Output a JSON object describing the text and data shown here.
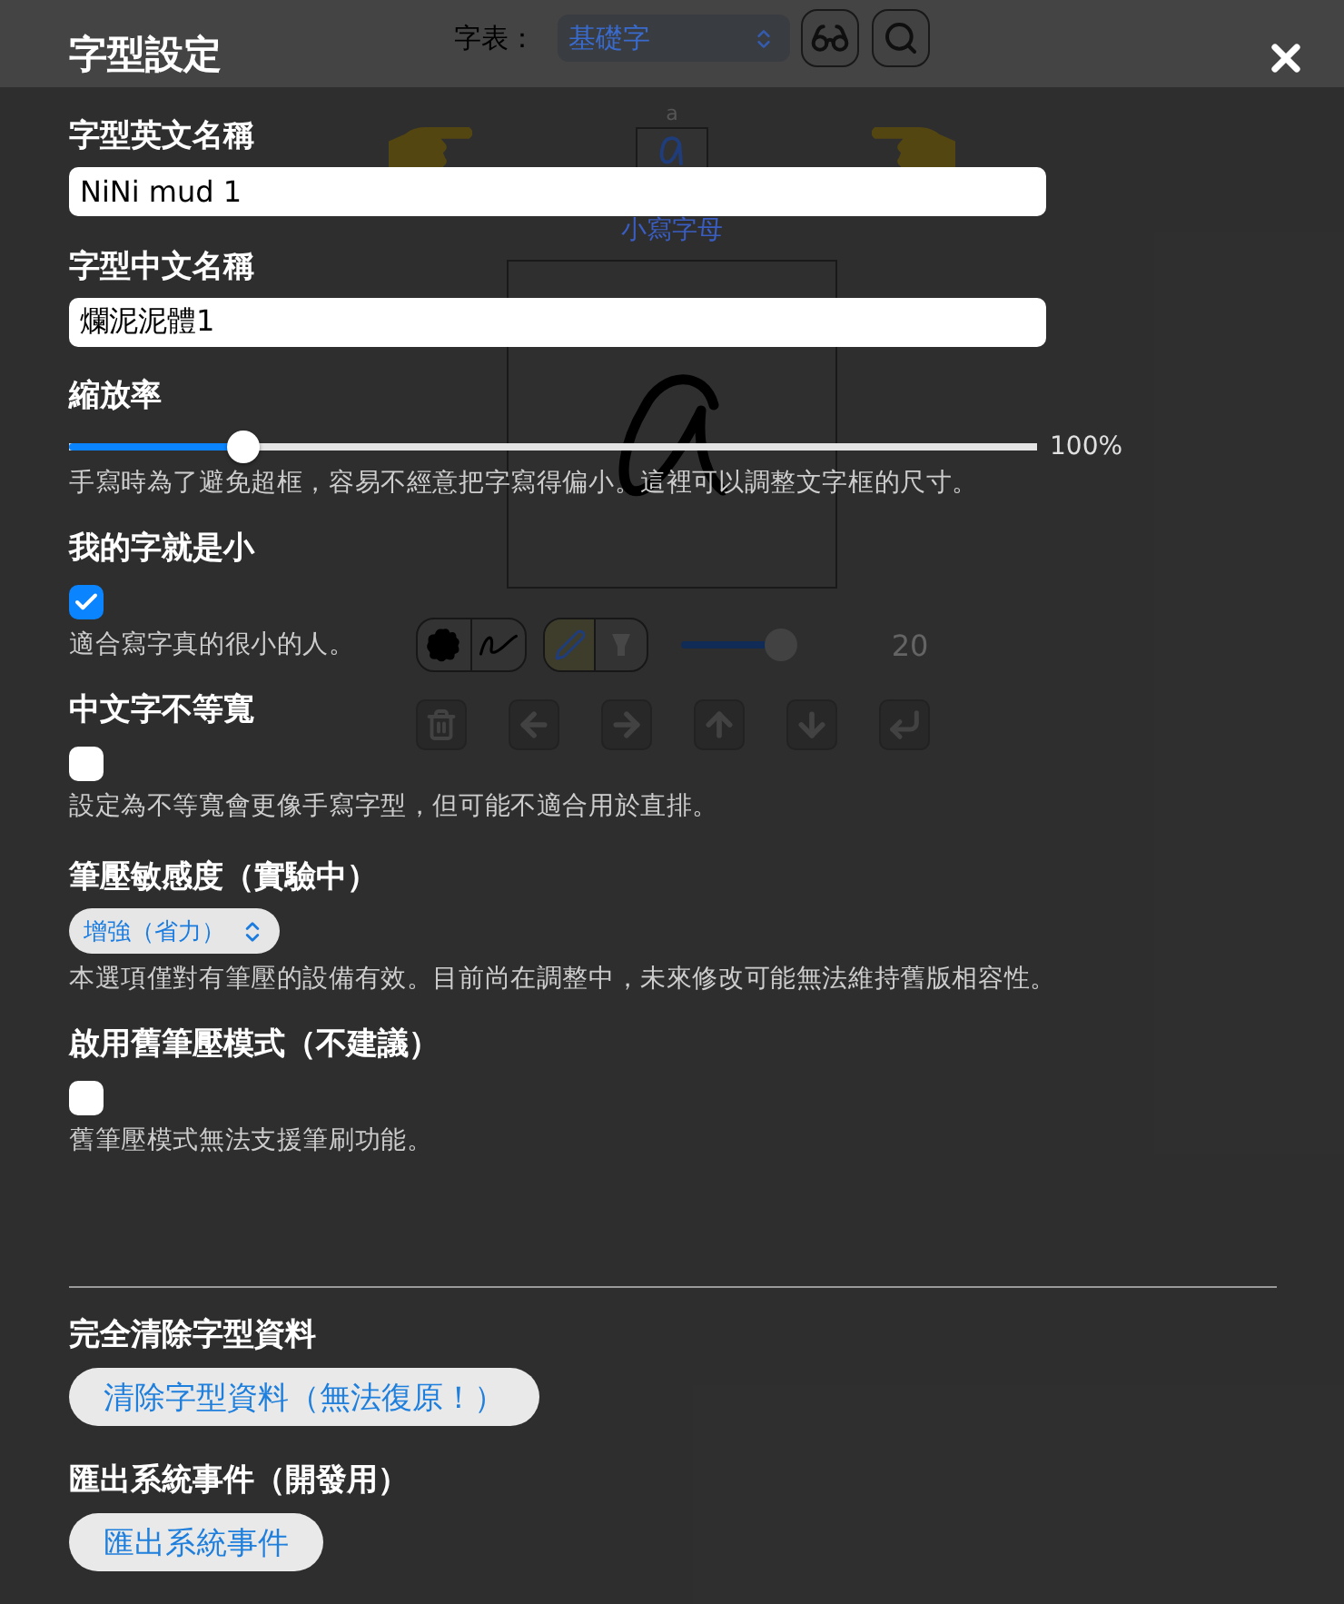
{
  "dialog": {
    "title": "字型設定"
  },
  "settings": [
    {
      "kind": "text",
      "label": "字型英文名稱",
      "value": "NiNi mud 1"
    },
    {
      "kind": "text",
      "label": "字型中文名稱",
      "value": "爛泥泥體1"
    },
    {
      "kind": "slider",
      "label": "縮放率",
      "level": 0.18,
      "reading": "100%",
      "hint": "手寫時為了避免超框，容易不經意把字寫得偏小。這裡可以調整文字框的尺寸。"
    },
    {
      "kind": "checkbox",
      "label": "我的字就是小",
      "checked": true,
      "hint": "適合寫字真的很小的人。"
    },
    {
      "kind": "checkbox",
      "label": "中文字不等寬",
      "checked": false,
      "hint": "設定為不等寬會更像手寫字型，但可能不適合用於直排。"
    },
    {
      "kind": "select",
      "label": "筆壓敏感度（實驗中）",
      "value": "增強（省力）",
      "hint": "本選項僅對有筆壓的設備有效。目前尚在調整中，未來修改可能無法維持舊版相容性。"
    },
    {
      "kind": "checkbox",
      "label": "啟用舊筆壓模式（不建議）",
      "checked": false,
      "hint": "舊筆壓模式無法支援筆刷功能。"
    }
  ],
  "actions": [
    {
      "label": "完全清除字型資料",
      "button": "清除字型資料（無法復原！）"
    },
    {
      "label": "匯出系統事件（開發用）",
      "button": "匯出系統事件"
    }
  ],
  "editor": {
    "toolbar": {
      "label": "字表：",
      "charset": "基礎字"
    },
    "glyph": {
      "caption": "a",
      "category": "小寫字母"
    },
    "brush_shapes": [
      {
        "kind": "blot",
        "selected": false
      },
      {
        "kind": "stroke",
        "selected": false
      }
    ],
    "pen_tools": [
      {
        "kind": "pen",
        "selected": true
      },
      {
        "kind": "funnel",
        "selected": false
      }
    ],
    "brush_size": {
      "level": 0.82,
      "reading": "20"
    }
  }
}
